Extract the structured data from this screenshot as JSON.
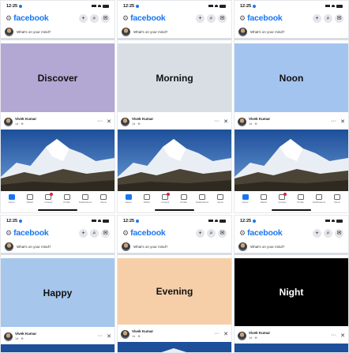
{
  "status": {
    "time": "12:25"
  },
  "app": {
    "brand": "facebook"
  },
  "composer": {
    "prompt": "What's on your mind?"
  },
  "post": {
    "author": "Vivek Kumar",
    "meta": "1d · ⊕",
    "close_label": "✕",
    "more_label": "···"
  },
  "nav": {
    "items": [
      {
        "label": "Home"
      },
      {
        "label": "Watch"
      },
      {
        "label": "Groups"
      },
      {
        "label": "Profile"
      },
      {
        "label": "Notifications"
      },
      {
        "label": "Menu"
      }
    ]
  },
  "screens": [
    {
      "tile_label": "Discover",
      "tile_bg": "#b3a8d4",
      "tile_fg": "#111111"
    },
    {
      "tile_label": "Morning",
      "tile_bg": "#d8dee4",
      "tile_fg": "#111111"
    },
    {
      "tile_label": "Noon",
      "tile_bg": "#a3c4ee",
      "tile_fg": "#111111"
    },
    {
      "tile_label": "Happy",
      "tile_bg": "#a6c6ec",
      "tile_fg": "#111111"
    },
    {
      "tile_label": "Evening",
      "tile_bg": "#f6cfa9",
      "tile_fg": "#111111"
    },
    {
      "tile_label": "Night",
      "tile_bg": "#000000",
      "tile_fg": "#ffffff"
    }
  ],
  "colors": {
    "brand_blue": "#1877f2",
    "badge_red": "#e41e3f"
  }
}
